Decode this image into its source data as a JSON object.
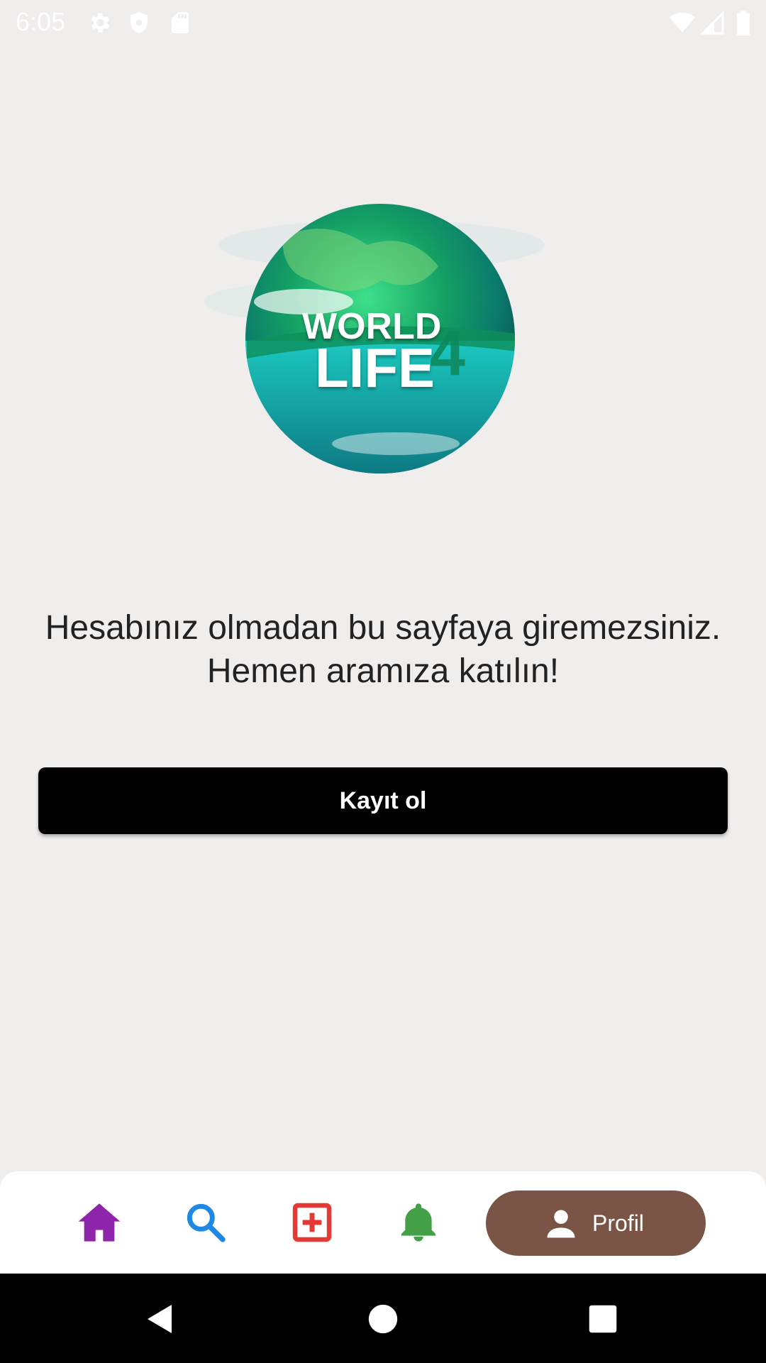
{
  "status_bar": {
    "time": "6:05",
    "icons": [
      "settings-gear-icon",
      "shield-icon",
      "sd-card-icon",
      "wifi-icon",
      "cell-signal-icon",
      "battery-icon"
    ]
  },
  "logo": {
    "line1": "WORLD",
    "line2": "LIFE",
    "number": "4"
  },
  "message": "Hesabınız olmadan bu sayfaya giremezsiniz. Hemen aramıza katılın!",
  "signup_button_label": "Kayıt ol",
  "bottom_nav": {
    "items": [
      {
        "icon": "home-icon",
        "color": "#8e24aa"
      },
      {
        "icon": "search-icon",
        "color": "#1e88e5"
      },
      {
        "icon": "add-box-icon",
        "color": "#e53935"
      },
      {
        "icon": "bell-icon",
        "color": "#43a047"
      }
    ],
    "profile_label": "Profil",
    "profile_color": "#7a5546"
  },
  "system_nav": [
    "back-icon",
    "home-circle-icon",
    "recents-icon"
  ]
}
